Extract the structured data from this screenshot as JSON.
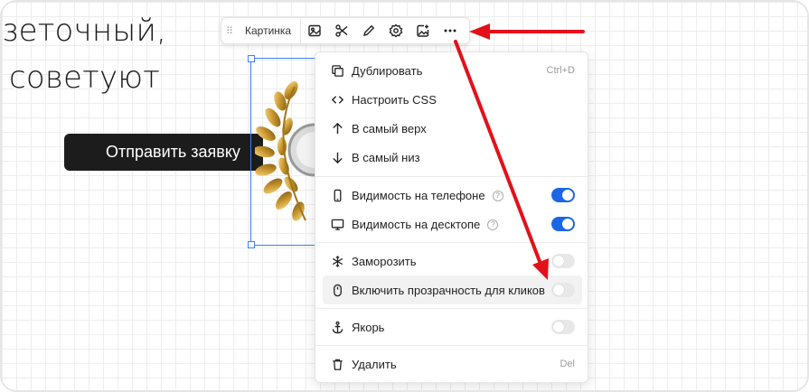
{
  "page": {
    "heading_line1": "зеточный,",
    "heading_line2": "советуют",
    "cta_label": "Отправить заявку"
  },
  "toolbar": {
    "label": "Картинка",
    "buttons": [
      {
        "icon": "image-icon"
      },
      {
        "icon": "scissors-icon"
      },
      {
        "icon": "pencil-icon"
      },
      {
        "icon": "gear-icon"
      },
      {
        "icon": "image-replace-icon"
      },
      {
        "icon": "more-dots-icon"
      }
    ]
  },
  "menu": {
    "duplicate": {
      "label": "Дублировать",
      "shortcut": "Ctrl+D",
      "icon": "copy-icon"
    },
    "css": {
      "label": "Настроить CSS",
      "icon": "code-icon"
    },
    "to_top": {
      "label": "В самый верх",
      "icon": "arrow-up-icon"
    },
    "to_bottom": {
      "label": "В самый низ",
      "icon": "arrow-down-icon"
    },
    "mobile_visibility": {
      "label": "Видимость на телефоне",
      "help": "?",
      "enabled": true,
      "icon": "phone-icon"
    },
    "desktop_visibility": {
      "label": "Видимость на десктопе",
      "help": "?",
      "enabled": true,
      "icon": "monitor-icon"
    },
    "freeze": {
      "label": "Заморозить",
      "enabled": false,
      "icon": "snowflake-icon"
    },
    "click_through": {
      "label": "Включить прозрачность для кликов",
      "enabled": false,
      "icon": "mouse-icon"
    },
    "anchor": {
      "label": "Якорь",
      "enabled": false,
      "icon": "anchor-icon"
    },
    "delete": {
      "label": "Удалить",
      "shortcut": "Del",
      "icon": "trash-icon"
    }
  },
  "colors": {
    "accent": "#1a66e6",
    "annotation_arrow": "#e3101a",
    "selection": "#3b82f6"
  }
}
